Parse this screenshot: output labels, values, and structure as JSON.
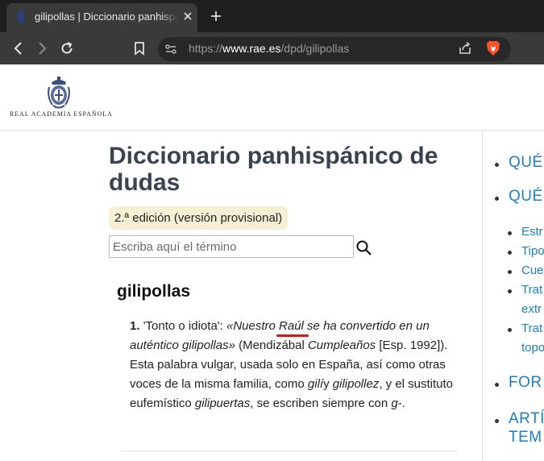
{
  "browser": {
    "tab_title": "gilipollas | Diccionario panhispánico de dudas",
    "url_scheme": "https://",
    "url_host": "www.rae.es",
    "url_path": "/dpd/gilipollas"
  },
  "header": {
    "org_name": "REAL ACADEMIA ESPAÑOLA"
  },
  "main": {
    "title": "Diccionario panhispánico de dudas",
    "edition": "2.ª edición (versión provisional)",
    "search_placeholder": "Escriba aquí el término"
  },
  "entry": {
    "headword": "gilipollas",
    "sense_number": "1.",
    "gloss": "'Tonto o idiota': ",
    "example_a": "«Nuestro ",
    "example_name": "Raúl",
    "example_b": " se ha convertido en un auténtico gilipollas»",
    "source_open": " (Mendizábal ",
    "source_work": "Cumpleaños",
    "source_close": " [Esp. 1992]). Esta palabra vulgar, usada solo en España, así como otras voces de la misma familia, como ",
    "word1": "gilí",
    "text1": "y ",
    "word2": "gilipollez",
    "text2": ", y el sustituto eufemístico ",
    "word3": "gilipuertas",
    "text3": ", se escriben siempre con ",
    "word4": "g-",
    "text4": "."
  },
  "sidebar": {
    "items": [
      "QUÉ",
      "QUÉ",
      "Estr",
      "Tipo",
      "Cue",
      "Trat",
      "extr",
      "Trat",
      "topo",
      "FOR",
      "ARTÍ",
      "TEM"
    ]
  },
  "colors": {
    "accent": "#1e7fbd",
    "title": "#3a4450",
    "badge_bg": "#f5efd3",
    "annotation": "#e01010"
  }
}
